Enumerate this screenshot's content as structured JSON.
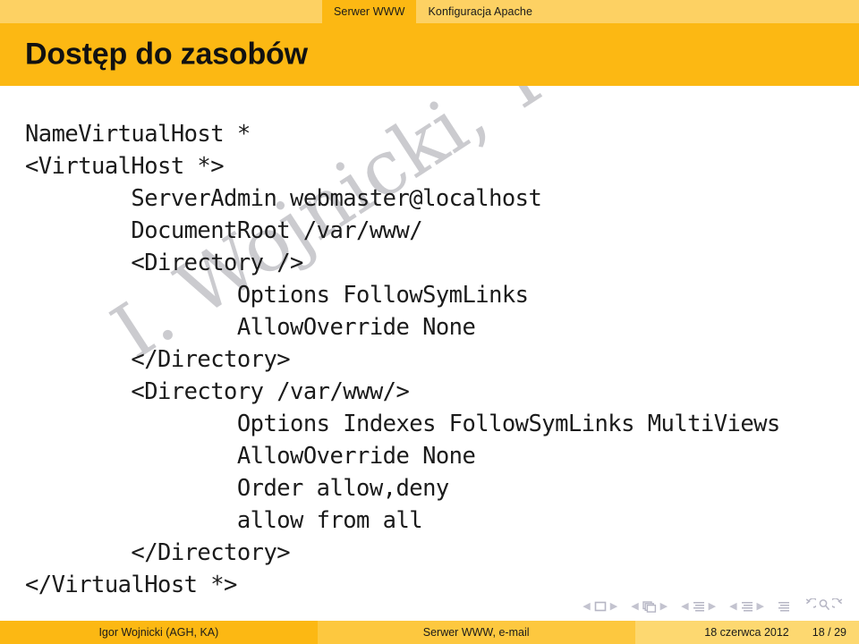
{
  "header": {
    "sections": [
      {
        "label": "Serwer WWW",
        "current": true
      },
      {
        "label": "Konfiguracja Apache",
        "current": false
      }
    ]
  },
  "title": {
    "text": "Dostęp do zasobów"
  },
  "watermark": {
    "text": "I. Wojnicki, Tech.Inter."
  },
  "code": {
    "lines": [
      "NameVirtualHost *",
      "<VirtualHost *>",
      "        ServerAdmin webmaster@localhost",
      "        DocumentRoot /var/www/",
      "        <Directory />",
      "                Options FollowSymLinks",
      "                AllowOverride None",
      "        </Directory>",
      "        <Directory /var/www/>",
      "                Options Indexes FollowSymLinks MultiViews",
      "                AllowOverride None",
      "                Order allow,deny",
      "                allow from all",
      "        </Directory>",
      "</VirtualHost *>"
    ]
  },
  "navsymbols": {
    "groups": [
      {
        "name": "slide-navigation",
        "icon": "slide-icon"
      },
      {
        "name": "frame-navigation",
        "icon": "frames-icon"
      },
      {
        "name": "subsection-navigation",
        "icon": "subsection-icon"
      },
      {
        "name": "section-navigation",
        "icon": "section-icon"
      }
    ],
    "presentation": "presentation-icon",
    "back": "back-icon",
    "search": "search-icon",
    "forward": "forward-icon",
    "prev_arrow": "◀",
    "next_arrow": "▶"
  },
  "footer": {
    "author": "Igor Wojnicki  (AGH, KA)",
    "title": "Serwer WWW, e-mail",
    "date": "18 czerwca 2012",
    "page": "18 / 29"
  },
  "colors": {
    "accent": "#fcb813",
    "accent_light": "#fdd163",
    "footer_mid": "#fdc83f",
    "footer_right": "#fdd870",
    "code_text": "#1b1b1b",
    "watermark": "#c9c9cd"
  }
}
